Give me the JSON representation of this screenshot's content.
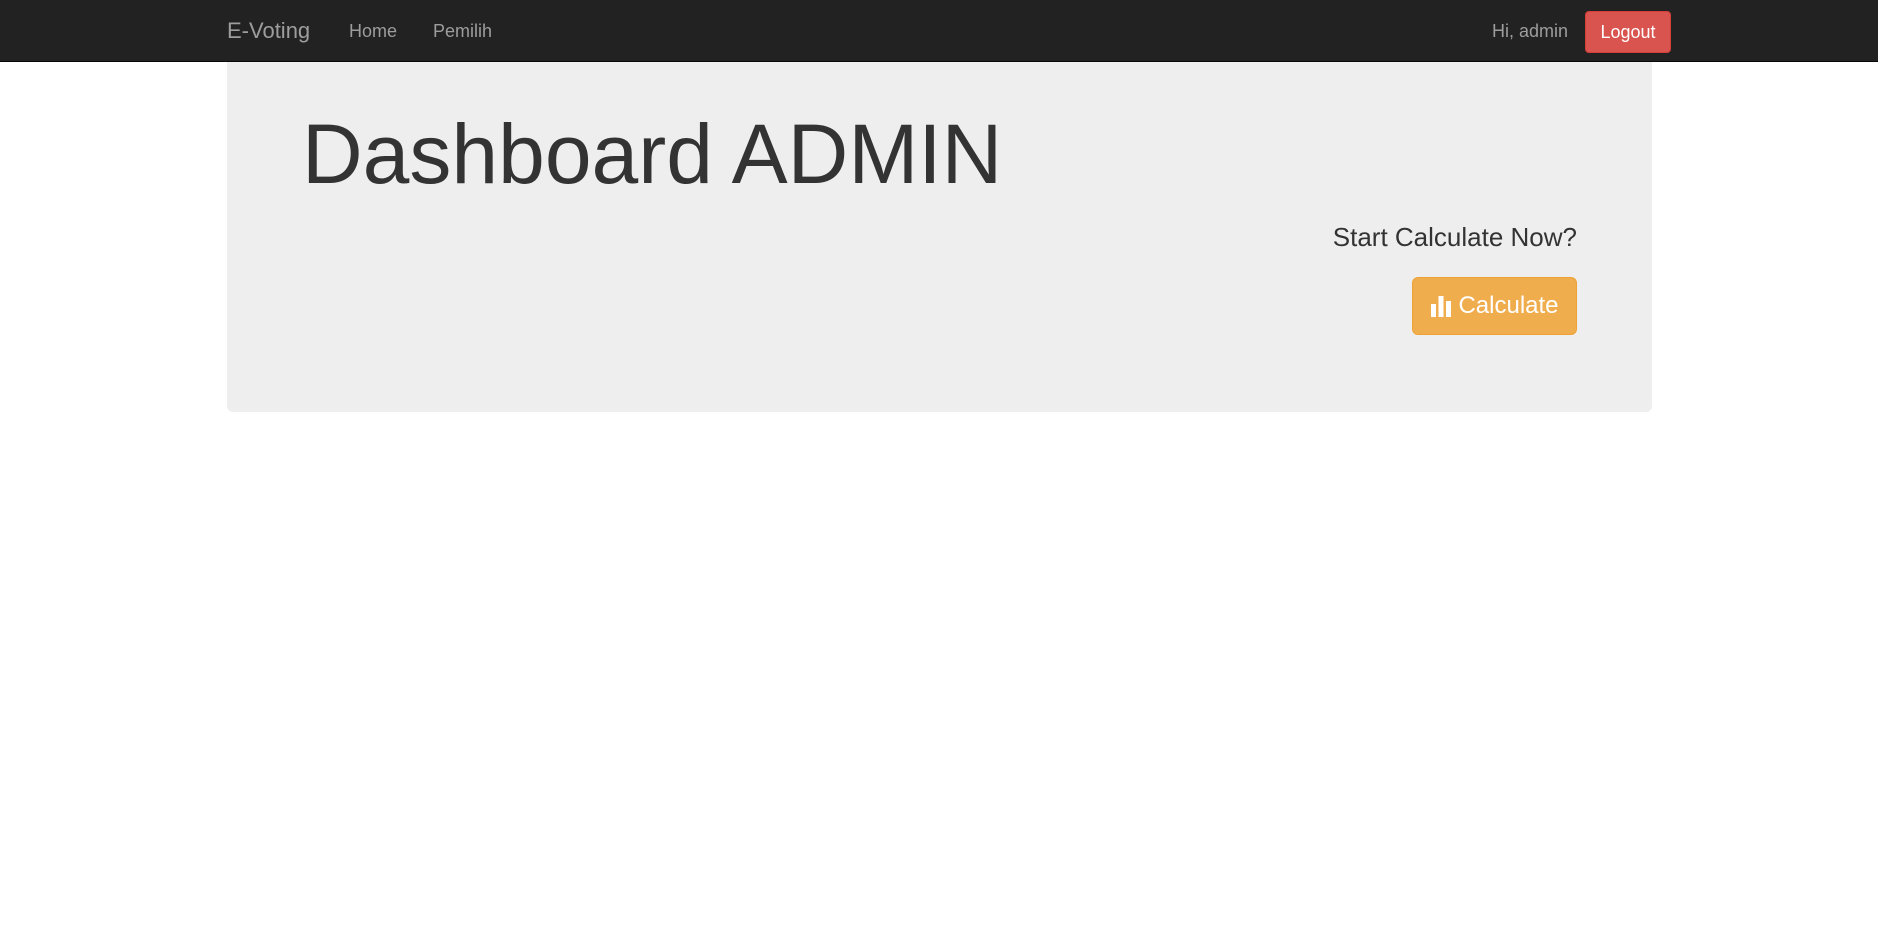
{
  "navbar": {
    "brand": "E-Voting",
    "links": [
      {
        "label": "Home"
      },
      {
        "label": "Pemilih"
      }
    ],
    "greeting": "Hi, admin",
    "logout_label": "Logout"
  },
  "main": {
    "title": "Dashboard ADMIN",
    "cta_text": "Start Calculate Now?",
    "calculate_label": "Calculate",
    "calculate_icon": "bar-chart-icon"
  },
  "colors": {
    "navbar_bg": "#222222",
    "logout": "#d9534f",
    "calculate": "#f0ad4e",
    "jumbotron_bg": "#eeeeee"
  }
}
